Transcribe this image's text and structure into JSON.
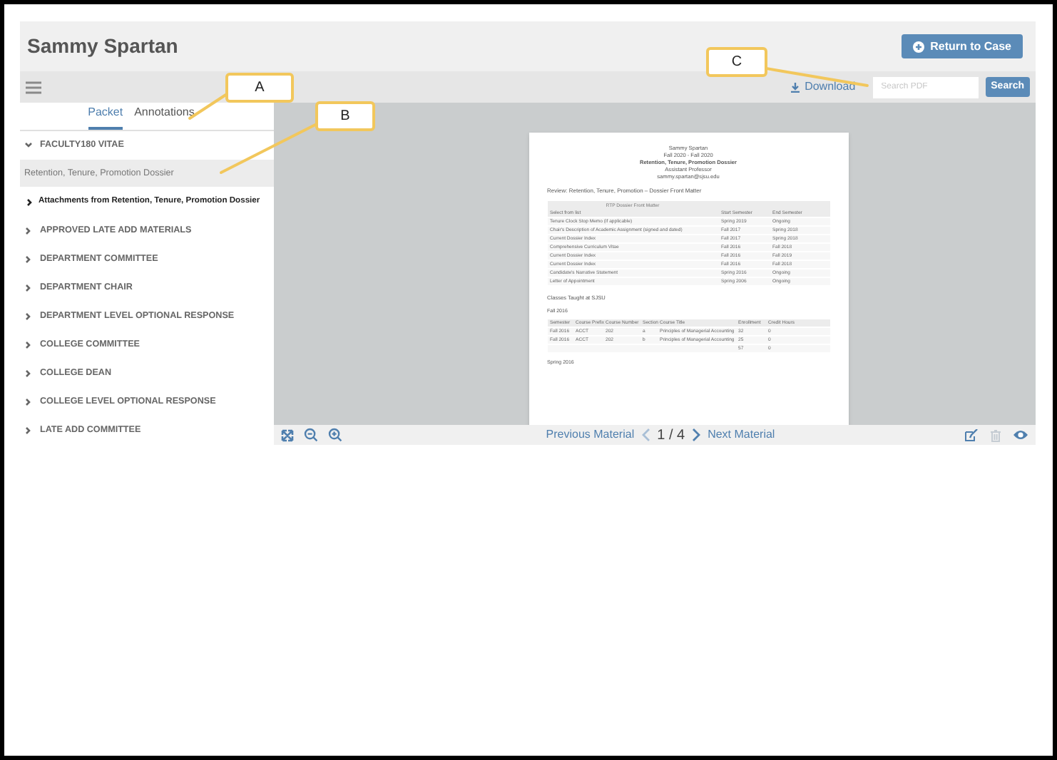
{
  "header": {
    "title": "Sammy Spartan",
    "return_button": "Return to Case"
  },
  "toolbar": {
    "download": "Download",
    "search": {
      "placeholder": "Search PDF"
    },
    "search_button": "Search"
  },
  "tabs": [
    {
      "label": "Packet",
      "selected": true
    },
    {
      "label": "Annotations",
      "selected": false
    }
  ],
  "sidebar": {
    "items": [
      {
        "label": "FACULTY180 VITAE",
        "expanded": true,
        "children": [
          {
            "label": "Retention, Tenure, Promotion Dossier",
            "kind": "document",
            "selected": true
          },
          {
            "label": "Attachments from Retention, Tenure, Promotion Dossier",
            "kind": "folder",
            "selected": false
          }
        ]
      },
      {
        "label": "APPROVED LATE ADD MATERIALS",
        "expanded": false
      },
      {
        "label": "DEPARTMENT COMMITTEE",
        "expanded": false
      },
      {
        "label": "DEPARTMENT CHAIR",
        "expanded": false
      },
      {
        "label": "DEPARTMENT LEVEL OPTIONAL RESPONSE",
        "expanded": false
      },
      {
        "label": "COLLEGE COMMITTEE",
        "expanded": false
      },
      {
        "label": "COLLEGE DEAN",
        "expanded": false
      },
      {
        "label": "COLLEGE LEVEL OPTIONAL RESPONSE",
        "expanded": false
      },
      {
        "label": "LATE ADD COMMITTEE",
        "expanded": false
      }
    ]
  },
  "document": {
    "heading": [
      "Sammy Spartan",
      "Fall 2020 - Fall 2020",
      "Retention, Tenure, Promotion Dossier",
      "Assistant Professor",
      "sammy.spartan@sjsu.edu"
    ],
    "section_title": "Review: Retention, Tenure, Promotion – Dossier Front Matter",
    "front_matter": {
      "caption": "RTP Dossier Front Matter",
      "columns": [
        "Select from list",
        "Start Semester",
        "End Semester"
      ],
      "rows": [
        [
          "Tenure Clock Stop Memo (if applicable)",
          "Spring 2019",
          "Ongoing"
        ],
        [
          "Chair's Description of Academic Assignment (signed and dated)",
          "Fall 2017",
          "Spring 2018"
        ],
        [
          "Current Dossier Index",
          "Fall 2017",
          "Spring 2018"
        ],
        [
          "Comprehensive Curriculum Vitae",
          "Fall 2016",
          "Fall 2018"
        ],
        [
          "Current Dossier Index",
          "Fall 2016",
          "Fall 2019"
        ],
        [
          "Current Dossier Index",
          "Fall 2016",
          "Fall 2018"
        ],
        [
          "Candidate's Narrative Statement",
          "Spring 2016",
          "Ongoing"
        ],
        [
          "Letter of Appointment",
          "Spring 2006",
          "Ongoing"
        ]
      ]
    },
    "classes_title": "Classes Taught at SJSU",
    "term": "Fall 2016",
    "classes": {
      "columns": [
        "Semester",
        "Course Prefix",
        "Course Number",
        "Section",
        "Course Title",
        "Enrollment",
        "Credit Hours"
      ],
      "rows": [
        [
          "Fall 2016",
          "ACCT",
          "202",
          "a",
          "Principles of Managerial Accounting",
          "32",
          "0"
        ],
        [
          "Fall 2016",
          "ACCT",
          "202",
          "b",
          "Principles of Managerial Accounting",
          "25",
          "0"
        ],
        [
          "",
          "",
          "",
          "",
          "",
          "57",
          "0"
        ]
      ]
    },
    "next_term": "Spring 2016"
  },
  "footer": {
    "previous": "Previous Material",
    "page": "1 / 4",
    "next": "Next Material"
  },
  "callouts": [
    {
      "label": "A"
    },
    {
      "label": "B"
    },
    {
      "label": "C"
    }
  ]
}
